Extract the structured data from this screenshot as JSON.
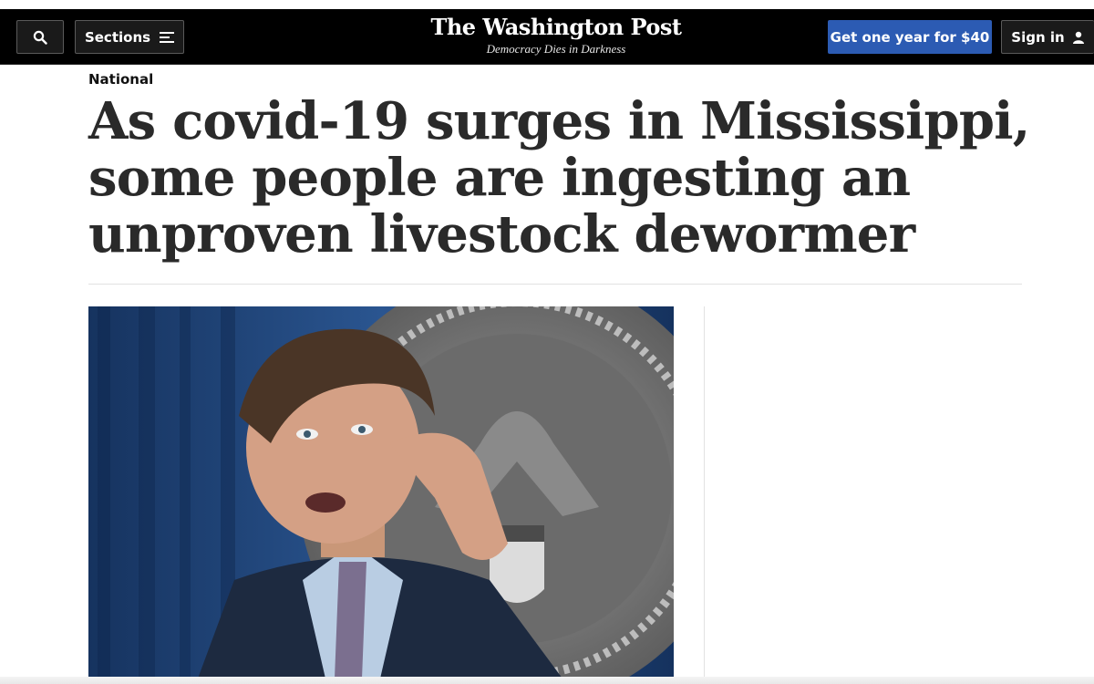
{
  "masthead": {
    "logo": "The Washington Post",
    "tagline": "Democracy Dies in Darkness",
    "sections_label": "Sections",
    "subscribe_label": "Get one year for $40",
    "signin_label": "Sign in",
    "colors": {
      "bar": "#000000",
      "subscribe": "#2c5bb3"
    },
    "icons": [
      "search-icon",
      "menu-icon",
      "user-icon"
    ]
  },
  "article": {
    "kicker": "National",
    "headline": "As covid-19 surges in Mississippi, some people are ingesting an unproven livestock dewormer"
  }
}
